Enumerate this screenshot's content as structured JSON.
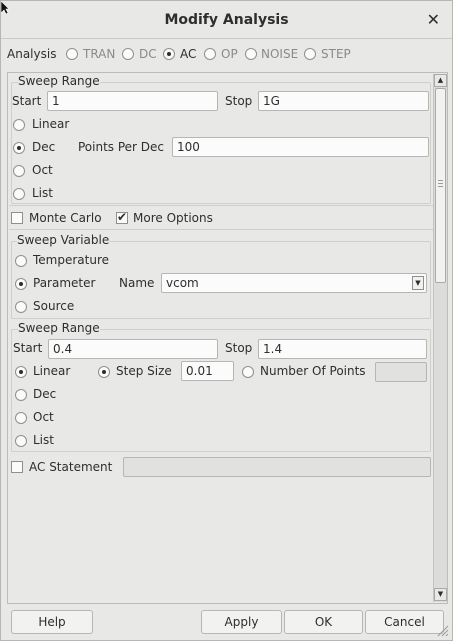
{
  "window": {
    "title": "Modify Analysis"
  },
  "analysis": {
    "label": "Analysis",
    "options": [
      "TRAN",
      "DC",
      "AC",
      "OP",
      "NOISE",
      "STEP"
    ],
    "selected": "AC"
  },
  "sweep_range_1": {
    "title": "Sweep Range",
    "start_label": "Start",
    "start_value": "1",
    "stop_label": "Stop",
    "stop_value": "1G",
    "types": [
      "Linear",
      "Dec",
      "Oct",
      "List"
    ],
    "selected": "Dec",
    "points_label": "Points Per Dec",
    "points_value": "100"
  },
  "options": {
    "monte_carlo": "Monte Carlo",
    "more_options": "More Options"
  },
  "sweep_variable": {
    "title": "Sweep Variable",
    "types": [
      "Temperature",
      "Parameter",
      "Source"
    ],
    "selected": "Parameter",
    "name_label": "Name",
    "name_value": "vcom"
  },
  "sweep_range_2": {
    "title": "Sweep Range",
    "start_label": "Start",
    "start_value": "0.4",
    "stop_label": "Stop",
    "stop_value": "1.4",
    "types": [
      "Linear",
      "Dec",
      "Oct",
      "List"
    ],
    "selected": "Linear",
    "step_size_label": "Step Size",
    "step_size_value": "0.01",
    "num_points_label": "Number Of Points",
    "num_points_value": ""
  },
  "ac_statement": {
    "label": "AC Statement",
    "value": ""
  },
  "buttons": {
    "help": "Help",
    "apply": "Apply",
    "ok": "OK",
    "cancel": "Cancel"
  },
  "icons": {
    "close": "close-icon",
    "scroll_up": "arrow-up-icon",
    "scroll_down": "arrow-down-icon",
    "combo": "chevron-down-icon"
  }
}
